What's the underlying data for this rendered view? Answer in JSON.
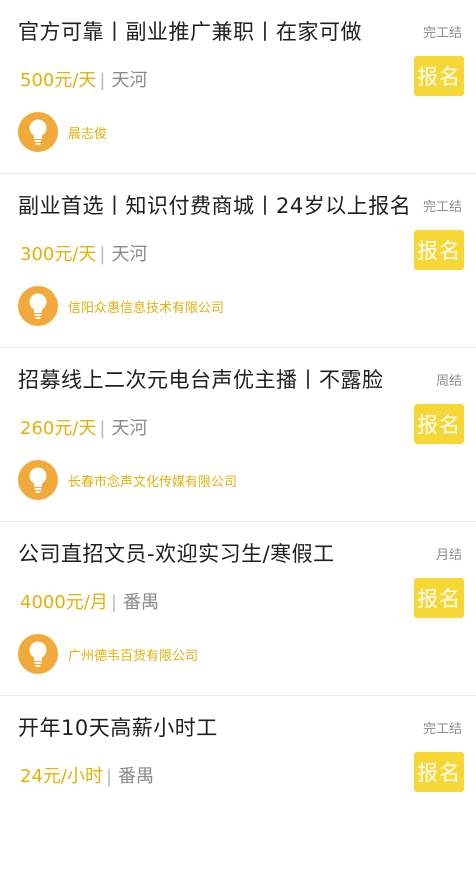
{
  "jobs": [
    {
      "title": "官方可靠丨副业推广兼职丨在家可做",
      "settlement": "完工结",
      "salary": "500元/天",
      "location": "天河",
      "apply_label": "报名",
      "company": "晨志俊"
    },
    {
      "title": "副业首选丨知识付费商城丨24岁以上报名",
      "settlement": "完工结",
      "salary": "300元/天",
      "location": "天河",
      "apply_label": "报名",
      "company": "信阳众惠信息技术有限公司"
    },
    {
      "title": "招募线上二次元电台声优主播丨不露脸",
      "settlement": "周结",
      "salary": "260元/天",
      "location": "天河",
      "apply_label": "报名",
      "company": "长春市念声文化传媒有限公司"
    },
    {
      "title": "公司直招文员-欢迎实习生/寒假工",
      "settlement": "月结",
      "salary": "4000元/月",
      "location": "番禺",
      "apply_label": "报名",
      "company": "广州德韦百货有限公司"
    },
    {
      "title": "开年10天高薪小时工",
      "settlement": "完工结",
      "salary": "24元/小时",
      "location": "番禺",
      "apply_label": "报名",
      "company": ""
    }
  ],
  "separator": "|",
  "colors": {
    "accent": "#e2b10a",
    "apply_bg": "#f7d736",
    "avatar_bg": "#f2a93b"
  },
  "icons": {
    "avatar": "lightbulb-icon"
  }
}
